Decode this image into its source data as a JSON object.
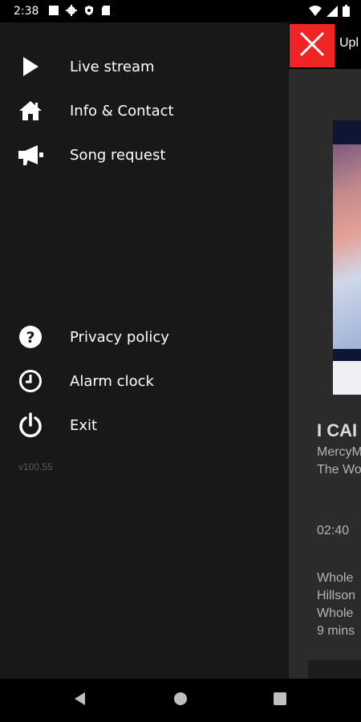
{
  "status_bar": {
    "time": "2:38",
    "left_icons": [
      "square-icon",
      "gear-icon",
      "shield-icon",
      "sd-card-icon"
    ],
    "right_icons": [
      "wifi-icon",
      "signal-icon",
      "battery-icon"
    ]
  },
  "drawer": {
    "items": [
      {
        "label": "Live stream",
        "icon": "play-icon"
      },
      {
        "label": "Info & Contact",
        "icon": "home-icon"
      },
      {
        "label": "Song request",
        "icon": "megaphone-icon"
      },
      {
        "label": "Privacy policy",
        "icon": "help-circle-icon"
      },
      {
        "label": "Alarm clock",
        "icon": "clock-icon"
      },
      {
        "label": "Exit",
        "icon": "power-icon"
      }
    ],
    "version": "v100.55"
  },
  "background_app": {
    "title": "Upl",
    "song_title": "I CAI",
    "artist": "MercyM",
    "album": "The Wo",
    "time": "02:40",
    "up_next": [
      "Whole",
      "Hillson",
      "Whole",
      "9 mins"
    ]
  },
  "colors": {
    "drawer_bg": "#181818",
    "close_red": "#f02424",
    "text_primary": "#ffffff",
    "text_secondary": "#b4b4b4"
  }
}
